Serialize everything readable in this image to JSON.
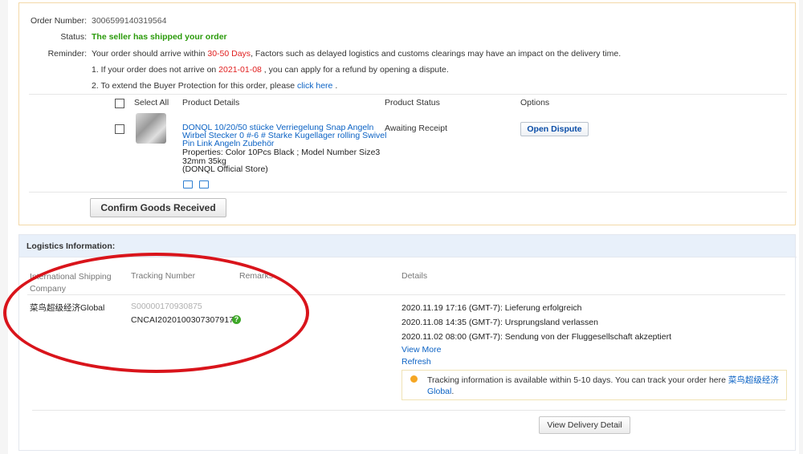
{
  "order": {
    "number_label": "Order Number:",
    "number_value": "3006599140319564",
    "status_label": "Status:",
    "status_value": "The seller has shipped your order",
    "reminder_label": "Reminder:",
    "reminder_prefix": "Your order should arrive within ",
    "reminder_days": "30-50 Days",
    "reminder_suffix": ", Factors such as delayed logistics and customs clearings may have an impact on the delivery time.",
    "line1_prefix": "1. If your order does not arrive on ",
    "line1_date": "2021-01-08",
    "line1_suffix": " , you can apply for a refund by opening a dispute.",
    "line2_prefix": "2. To extend the Buyer Protection for this order, please ",
    "line2_link": "click here",
    "line2_suffix": " ."
  },
  "table": {
    "select_all": "Select All",
    "col_product": "Product Details",
    "col_status": "Product Status",
    "col_options": "Options"
  },
  "product": {
    "title_line1": "DONQL 10/20/50 stücke Verriegelung Snap Angeln",
    "title_line2": "Wirbel Stecker 0 #-6 # Starke Kugellager rolling Swivel",
    "title_line3": "Pin Link Angeln Zubehör",
    "props_line1": "Properties: Color 10Pcs Black   ; Model Number Size3",
    "props_line2": "32mm 35kg",
    "store": "(DONQL Official Store)",
    "status": "Awaiting Receipt",
    "dispute_button": "Open Dispute"
  },
  "confirm_button": "Confirm Goods Received",
  "logistics": {
    "title": "Logistics Information:",
    "col_company_1": "International Shipping",
    "col_company_2": "Company",
    "col_tracking": "Tracking Number",
    "col_remarks": "Remarks",
    "col_details": "Details",
    "company": "菜鸟超级经济Global",
    "tracking_old": "S00000170930875",
    "tracking": "CNCAI2020100307307917",
    "help_glyph": "?",
    "events": [
      "2020.11.19 17:16 (GMT-7): Lieferung erfolgreich",
      "2020.11.08 14:35 (GMT-7): Ursprungsland verlassen",
      "2020.11.02 08:00 (GMT-7): Sendung von der Fluggesellschaft akzeptiert"
    ],
    "view_more": "View More",
    "refresh": "Refresh",
    "tip_prefix": "Tracking information is available within 5-10 days. You can track your order here ",
    "tip_link_1": "菜鸟超级经济",
    "tip_link_2": "Global",
    "tip_suffix": ".",
    "delivery_button": "View Delivery Detail"
  },
  "colors": {
    "annotation": "#d9141b",
    "link": "#0b62c4",
    "status_green": "#2a9a0a"
  }
}
